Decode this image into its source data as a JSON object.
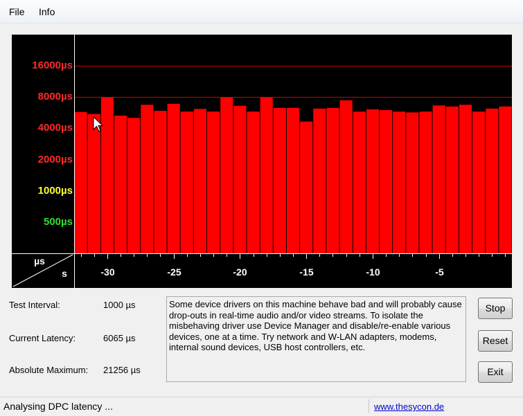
{
  "menu": {
    "file": "File",
    "info": "Info"
  },
  "chart_data": {
    "type": "bar",
    "title": "",
    "y_scale": "log",
    "ylim_us": [
      250,
      32000
    ],
    "reference_lines_us": [
      8000,
      16000
    ],
    "y_ticks": [
      {
        "label": "16000µs",
        "value": 16000,
        "color": "#ff2a2a"
      },
      {
        "label": "8000µs",
        "value": 8000,
        "color": "#ff2a2a"
      },
      {
        "label": "4000µs",
        "value": 4000,
        "color": "#ff2a2a"
      },
      {
        "label": "2000µs",
        "value": 2000,
        "color": "#ff2a2a"
      },
      {
        "label": "1000µs",
        "value": 1000,
        "color": "#ffff33"
      },
      {
        "label": "500µs",
        "value": 500,
        "color": "#33dd33"
      }
    ],
    "axis_corner_top": "µs",
    "axis_corner_bottom": "s",
    "x_ticks": [
      {
        "label": "-30",
        "value": -30
      },
      {
        "label": "-25",
        "value": -25
      },
      {
        "label": "-20",
        "value": -20
      },
      {
        "label": "-15",
        "value": -15
      },
      {
        "label": "-10",
        "value": -10
      },
      {
        "label": "-5",
        "value": -5
      }
    ],
    "xlim_s": [
      -32.5,
      0.5
    ],
    "series": [
      {
        "x": [
          -32,
          -31,
          -30,
          -29,
          -28,
          -27,
          -26,
          -25,
          -24,
          -23,
          -22,
          -21,
          -20,
          -19,
          -18,
          -17,
          -16,
          -15,
          -14,
          -13,
          -12,
          -11,
          -10,
          -9,
          -8,
          -7,
          -6,
          -5,
          -4,
          -3,
          -2,
          -1,
          0
        ],
        "values": [
          5750,
          5500,
          8000,
          5300,
          5050,
          6750,
          5900,
          6900,
          5800,
          6150,
          5800,
          8000,
          6600,
          5800,
          8000,
          6300,
          6300,
          4650,
          6200,
          6300,
          7450,
          5800,
          6100,
          6000,
          5800,
          5700,
          5800,
          6650,
          6500,
          6750,
          5800,
          6200,
          6500
        ],
        "color": "#ff0000"
      }
    ]
  },
  "info": {
    "test_interval_label": "Test Interval:",
    "test_interval_value": "1000 µs",
    "current_latency_label": "Current Latency:",
    "current_latency_value": "6065 µs",
    "absolute_maximum_label": "Absolute Maximum:",
    "absolute_maximum_value": "21256 µs"
  },
  "message": "Some device drivers on this machine behave bad and will probably cause drop-outs in real-time audio and/or video streams. To isolate the misbehaving driver use Device Manager and disable/re-enable various devices, one at a time. Try network and W-LAN adapters, modems, internal sound devices, USB host controllers, etc.",
  "buttons": {
    "stop": "Stop",
    "reset": "Reset",
    "exit": "Exit"
  },
  "status": {
    "text": "Analysing DPC latency ...",
    "link": "www.thesycon.de"
  }
}
